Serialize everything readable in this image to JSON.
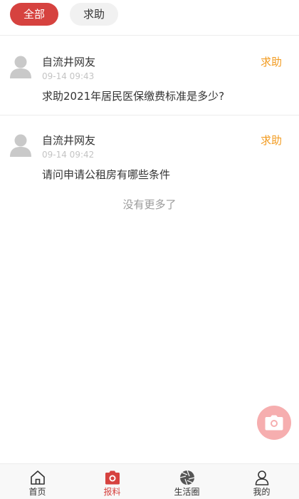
{
  "filters": {
    "all_label": "全部",
    "help_label": "求助"
  },
  "posts": [
    {
      "author": "自流井网友",
      "time": "09-14 09:43",
      "content": "求助2021年居民医保缴费标准是多少?",
      "tag": "求助"
    },
    {
      "author": "自流井网友",
      "time": "09-14 09:42",
      "content": "请问申请公租房有哪些条件",
      "tag": "求助"
    }
  ],
  "list_end_text": "没有更多了",
  "tabbar": {
    "items": [
      {
        "label": "首页",
        "icon": "home-icon"
      },
      {
        "label": "报料",
        "icon": "camera-icon"
      },
      {
        "label": "生活圈",
        "icon": "aperture-icon"
      },
      {
        "label": "我的",
        "icon": "user-icon"
      }
    ],
    "active_index": 1
  },
  "colors": {
    "accent": "#d6423f",
    "tag": "#f29b20",
    "fab": "#f6aeaf"
  }
}
